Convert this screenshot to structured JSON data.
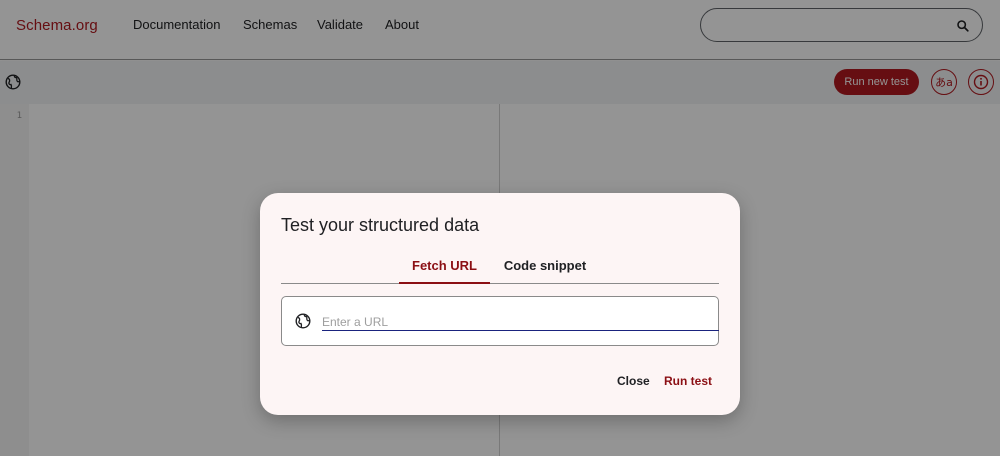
{
  "header": {
    "logo": "Schema.org",
    "nav": [
      "Documentation",
      "Schemas",
      "Validate",
      "About"
    ],
    "search": {
      "value": "",
      "icon": "search-icon"
    }
  },
  "toolbar": {
    "run_new_test_label": "Run new test",
    "language_button_label": "あa",
    "icons": [
      "globe-icon",
      "translate-icon",
      "info-icon"
    ]
  },
  "editor": {
    "line_numbers": [
      "1"
    ]
  },
  "dialog": {
    "title": "Test your structured data",
    "tabs": [
      {
        "label": "Fetch URL",
        "active": true
      },
      {
        "label": "Code snippet",
        "active": false
      }
    ],
    "url_input": {
      "placeholder": "Enter a URL",
      "value": ""
    },
    "close_label": "Close",
    "run_label": "Run test"
  },
  "colors": {
    "brand": "#b0191f",
    "accent_dark": "#8b0f14",
    "input_underline": "#1a237e",
    "dialog_bg": "#fdf5f5"
  }
}
